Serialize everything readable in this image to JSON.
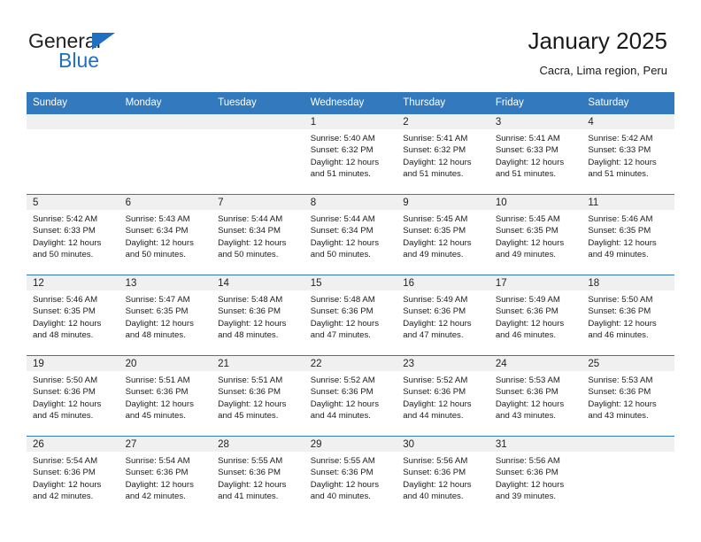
{
  "brand": {
    "name_top": "General",
    "name_bottom": "Blue",
    "triangle_color": "#1f70c1"
  },
  "header": {
    "title": "January 2025",
    "subtitle": "Cacra, Lima region, Peru"
  },
  "theme": {
    "header_row_bg": "#3379bd",
    "daynum_band_bg": "#f0f0f0",
    "row_divider": "#3379bd",
    "text": "#1a1a1a"
  },
  "weekday_headers": [
    "Sunday",
    "Monday",
    "Tuesday",
    "Wednesday",
    "Thursday",
    "Friday",
    "Saturday"
  ],
  "labels": {
    "sunrise_prefix": "Sunrise: ",
    "sunset_prefix": "Sunset: ",
    "daylight_prefix": "Daylight: "
  },
  "weeks": [
    [
      {
        "empty": true
      },
      {
        "empty": true
      },
      {
        "empty": true
      },
      {
        "day": "1",
        "sunrise": "Sunrise: 5:40 AM",
        "sunset": "Sunset: 6:32 PM",
        "daylight": "Daylight: 12 hours and 51 minutes."
      },
      {
        "day": "2",
        "sunrise": "Sunrise: 5:41 AM",
        "sunset": "Sunset: 6:32 PM",
        "daylight": "Daylight: 12 hours and 51 minutes."
      },
      {
        "day": "3",
        "sunrise": "Sunrise: 5:41 AM",
        "sunset": "Sunset: 6:33 PM",
        "daylight": "Daylight: 12 hours and 51 minutes."
      },
      {
        "day": "4",
        "sunrise": "Sunrise: 5:42 AM",
        "sunset": "Sunset: 6:33 PM",
        "daylight": "Daylight: 12 hours and 51 minutes."
      }
    ],
    [
      {
        "day": "5",
        "sunrise": "Sunrise: 5:42 AM",
        "sunset": "Sunset: 6:33 PM",
        "daylight": "Daylight: 12 hours and 50 minutes."
      },
      {
        "day": "6",
        "sunrise": "Sunrise: 5:43 AM",
        "sunset": "Sunset: 6:34 PM",
        "daylight": "Daylight: 12 hours and 50 minutes."
      },
      {
        "day": "7",
        "sunrise": "Sunrise: 5:44 AM",
        "sunset": "Sunset: 6:34 PM",
        "daylight": "Daylight: 12 hours and 50 minutes."
      },
      {
        "day": "8",
        "sunrise": "Sunrise: 5:44 AM",
        "sunset": "Sunset: 6:34 PM",
        "daylight": "Daylight: 12 hours and 50 minutes."
      },
      {
        "day": "9",
        "sunrise": "Sunrise: 5:45 AM",
        "sunset": "Sunset: 6:35 PM",
        "daylight": "Daylight: 12 hours and 49 minutes."
      },
      {
        "day": "10",
        "sunrise": "Sunrise: 5:45 AM",
        "sunset": "Sunset: 6:35 PM",
        "daylight": "Daylight: 12 hours and 49 minutes."
      },
      {
        "day": "11",
        "sunrise": "Sunrise: 5:46 AM",
        "sunset": "Sunset: 6:35 PM",
        "daylight": "Daylight: 12 hours and 49 minutes."
      }
    ],
    [
      {
        "day": "12",
        "sunrise": "Sunrise: 5:46 AM",
        "sunset": "Sunset: 6:35 PM",
        "daylight": "Daylight: 12 hours and 48 minutes."
      },
      {
        "day": "13",
        "sunrise": "Sunrise: 5:47 AM",
        "sunset": "Sunset: 6:35 PM",
        "daylight": "Daylight: 12 hours and 48 minutes."
      },
      {
        "day": "14",
        "sunrise": "Sunrise: 5:48 AM",
        "sunset": "Sunset: 6:36 PM",
        "daylight": "Daylight: 12 hours and 48 minutes."
      },
      {
        "day": "15",
        "sunrise": "Sunrise: 5:48 AM",
        "sunset": "Sunset: 6:36 PM",
        "daylight": "Daylight: 12 hours and 47 minutes."
      },
      {
        "day": "16",
        "sunrise": "Sunrise: 5:49 AM",
        "sunset": "Sunset: 6:36 PM",
        "daylight": "Daylight: 12 hours and 47 minutes."
      },
      {
        "day": "17",
        "sunrise": "Sunrise: 5:49 AM",
        "sunset": "Sunset: 6:36 PM",
        "daylight": "Daylight: 12 hours and 46 minutes."
      },
      {
        "day": "18",
        "sunrise": "Sunrise: 5:50 AM",
        "sunset": "Sunset: 6:36 PM",
        "daylight": "Daylight: 12 hours and 46 minutes."
      }
    ],
    [
      {
        "day": "19",
        "sunrise": "Sunrise: 5:50 AM",
        "sunset": "Sunset: 6:36 PM",
        "daylight": "Daylight: 12 hours and 45 minutes."
      },
      {
        "day": "20",
        "sunrise": "Sunrise: 5:51 AM",
        "sunset": "Sunset: 6:36 PM",
        "daylight": "Daylight: 12 hours and 45 minutes."
      },
      {
        "day": "21",
        "sunrise": "Sunrise: 5:51 AM",
        "sunset": "Sunset: 6:36 PM",
        "daylight": "Daylight: 12 hours and 45 minutes."
      },
      {
        "day": "22",
        "sunrise": "Sunrise: 5:52 AM",
        "sunset": "Sunset: 6:36 PM",
        "daylight": "Daylight: 12 hours and 44 minutes."
      },
      {
        "day": "23",
        "sunrise": "Sunrise: 5:52 AM",
        "sunset": "Sunset: 6:36 PM",
        "daylight": "Daylight: 12 hours and 44 minutes."
      },
      {
        "day": "24",
        "sunrise": "Sunrise: 5:53 AM",
        "sunset": "Sunset: 6:36 PM",
        "daylight": "Daylight: 12 hours and 43 minutes."
      },
      {
        "day": "25",
        "sunrise": "Sunrise: 5:53 AM",
        "sunset": "Sunset: 6:36 PM",
        "daylight": "Daylight: 12 hours and 43 minutes."
      }
    ],
    [
      {
        "day": "26",
        "sunrise": "Sunrise: 5:54 AM",
        "sunset": "Sunset: 6:36 PM",
        "daylight": "Daylight: 12 hours and 42 minutes."
      },
      {
        "day": "27",
        "sunrise": "Sunrise: 5:54 AM",
        "sunset": "Sunset: 6:36 PM",
        "daylight": "Daylight: 12 hours and 42 minutes."
      },
      {
        "day": "28",
        "sunrise": "Sunrise: 5:55 AM",
        "sunset": "Sunset: 6:36 PM",
        "daylight": "Daylight: 12 hours and 41 minutes."
      },
      {
        "day": "29",
        "sunrise": "Sunrise: 5:55 AM",
        "sunset": "Sunset: 6:36 PM",
        "daylight": "Daylight: 12 hours and 40 minutes."
      },
      {
        "day": "30",
        "sunrise": "Sunrise: 5:56 AM",
        "sunset": "Sunset: 6:36 PM",
        "daylight": "Daylight: 12 hours and 40 minutes."
      },
      {
        "day": "31",
        "sunrise": "Sunrise: 5:56 AM",
        "sunset": "Sunset: 6:36 PM",
        "daylight": "Daylight: 12 hours and 39 minutes."
      },
      {
        "empty": true
      }
    ]
  ]
}
